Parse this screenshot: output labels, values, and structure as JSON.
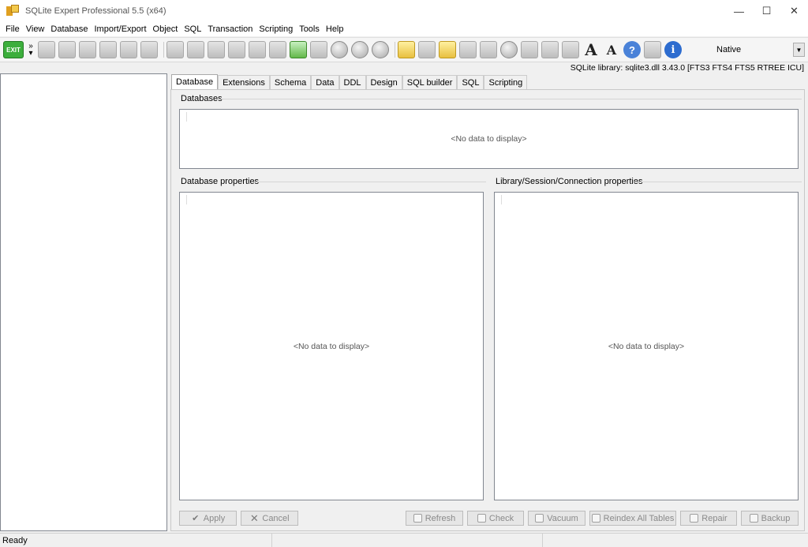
{
  "window": {
    "title": "SQLite Expert Professional 5.5 (x64)",
    "minimize_glyph": "—",
    "maximize_glyph": "☐",
    "close_glyph": "✕"
  },
  "menu": [
    "File",
    "View",
    "Database",
    "Import/Export",
    "Object",
    "SQL",
    "Transaction",
    "Scripting",
    "Tools",
    "Help"
  ],
  "toolbar": {
    "exit_label": "EXIT",
    "native_value": "Native",
    "font_increase_glyph": "A",
    "font_decrease_glyph": "A",
    "help_glyph": "?",
    "info_glyph": "i",
    "icons": [
      "new-database-icon",
      "open-database-icon",
      "attach-database-icon",
      "detach-database-icon",
      "close-database-icon",
      "execute-icon",
      "query-icon"
    ]
  },
  "library_info": "SQLite library: sqlite3.dll 3.43.0 [FTS3 FTS4 FTS5 RTREE ICU]",
  "tabs": [
    "Database",
    "Extensions",
    "Schema",
    "Data",
    "DDL",
    "Design",
    "SQL builder",
    "SQL",
    "Scripting"
  ],
  "active_tab": "Database",
  "sections": {
    "databases": {
      "label": "Databases",
      "empty": "<No data to display>"
    },
    "db_properties": {
      "label": "Database properties",
      "empty": "<No data to display>"
    },
    "lib_properties": {
      "label": "Library/Session/Connection properties",
      "empty": "<No data to display>"
    }
  },
  "buttons": {
    "apply": "Apply",
    "cancel": "Cancel",
    "refresh": "Refresh",
    "check": "Check",
    "vacuum": "Vacuum",
    "reindex": "Reindex All Tables",
    "repair": "Repair",
    "backup": "Backup"
  },
  "status": {
    "text": "Ready"
  }
}
